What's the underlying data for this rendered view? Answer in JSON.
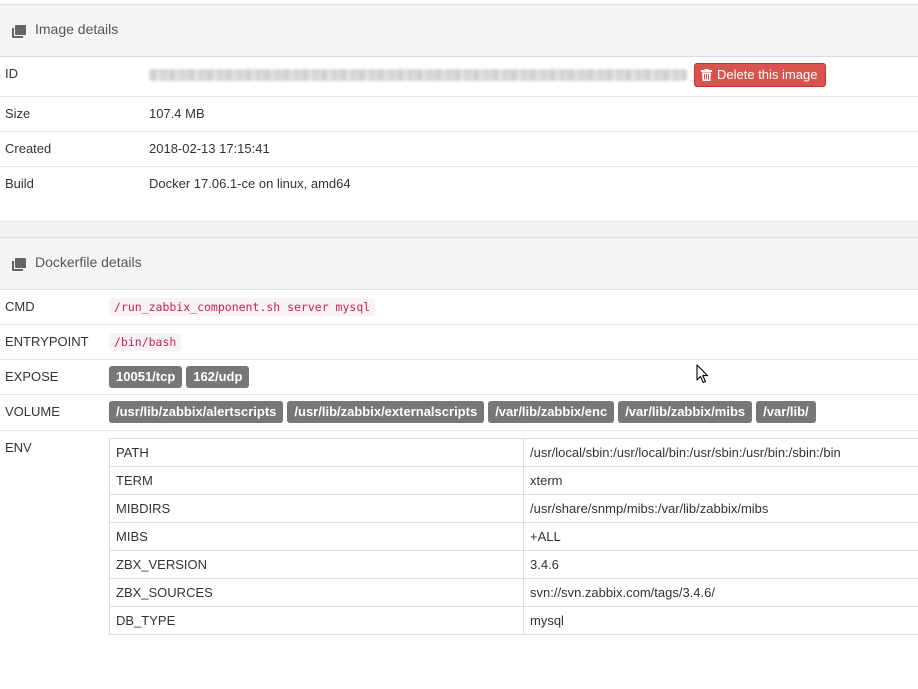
{
  "image_details": {
    "title": "Image details",
    "rows": {
      "id": {
        "label": "ID"
      },
      "size": {
        "label": "Size",
        "value": "107.4 MB"
      },
      "created": {
        "label": "Created",
        "value": "2018-02-13 17:15:41"
      },
      "build": {
        "label": "Build",
        "value": "Docker 17.06.1-ce on linux, amd64"
      }
    },
    "delete_button": "Delete this image"
  },
  "dockerfile_details": {
    "title": "Dockerfile details",
    "cmd": {
      "label": "CMD",
      "value": "/run_zabbix_component.sh server mysql"
    },
    "entrypoint": {
      "label": "ENTRYPOINT",
      "value": "/bin/bash"
    },
    "expose": {
      "label": "EXPOSE",
      "ports": [
        "10051/tcp",
        "162/udp"
      ]
    },
    "volume": {
      "label": "VOLUME",
      "paths": [
        "/usr/lib/zabbix/alertscripts",
        "/usr/lib/zabbix/externalscripts",
        "/var/lib/zabbix/enc",
        "/var/lib/zabbix/mibs",
        "/var/lib/"
      ]
    },
    "env": {
      "label": "ENV",
      "rows": [
        {
          "key": "PATH",
          "value": "/usr/local/sbin:/usr/local/bin:/usr/sbin:/usr/bin:/sbin:/bin"
        },
        {
          "key": "TERM",
          "value": "xterm"
        },
        {
          "key": "MIBDIRS",
          "value": "/usr/share/snmp/mibs:/var/lib/zabbix/mibs"
        },
        {
          "key": "MIBS",
          "value": "+ALL"
        },
        {
          "key": "ZBX_VERSION",
          "value": "3.4.6"
        },
        {
          "key": "ZBX_SOURCES",
          "value": "svn://svn.zabbix.com/tags/3.4.6/"
        },
        {
          "key": "DB_TYPE",
          "value": "mysql"
        }
      ]
    }
  },
  "icons": {
    "panel_icon": "clone-icon",
    "delete_icon": "trash-icon",
    "cursor": "mouse-pointer-icon"
  },
  "colors": {
    "danger": "#d9534f",
    "label_badge": "#777777",
    "code_text": "#c7254e",
    "code_bg": "#f9f2f4",
    "panel_heading_bg": "#f5f5f5"
  }
}
